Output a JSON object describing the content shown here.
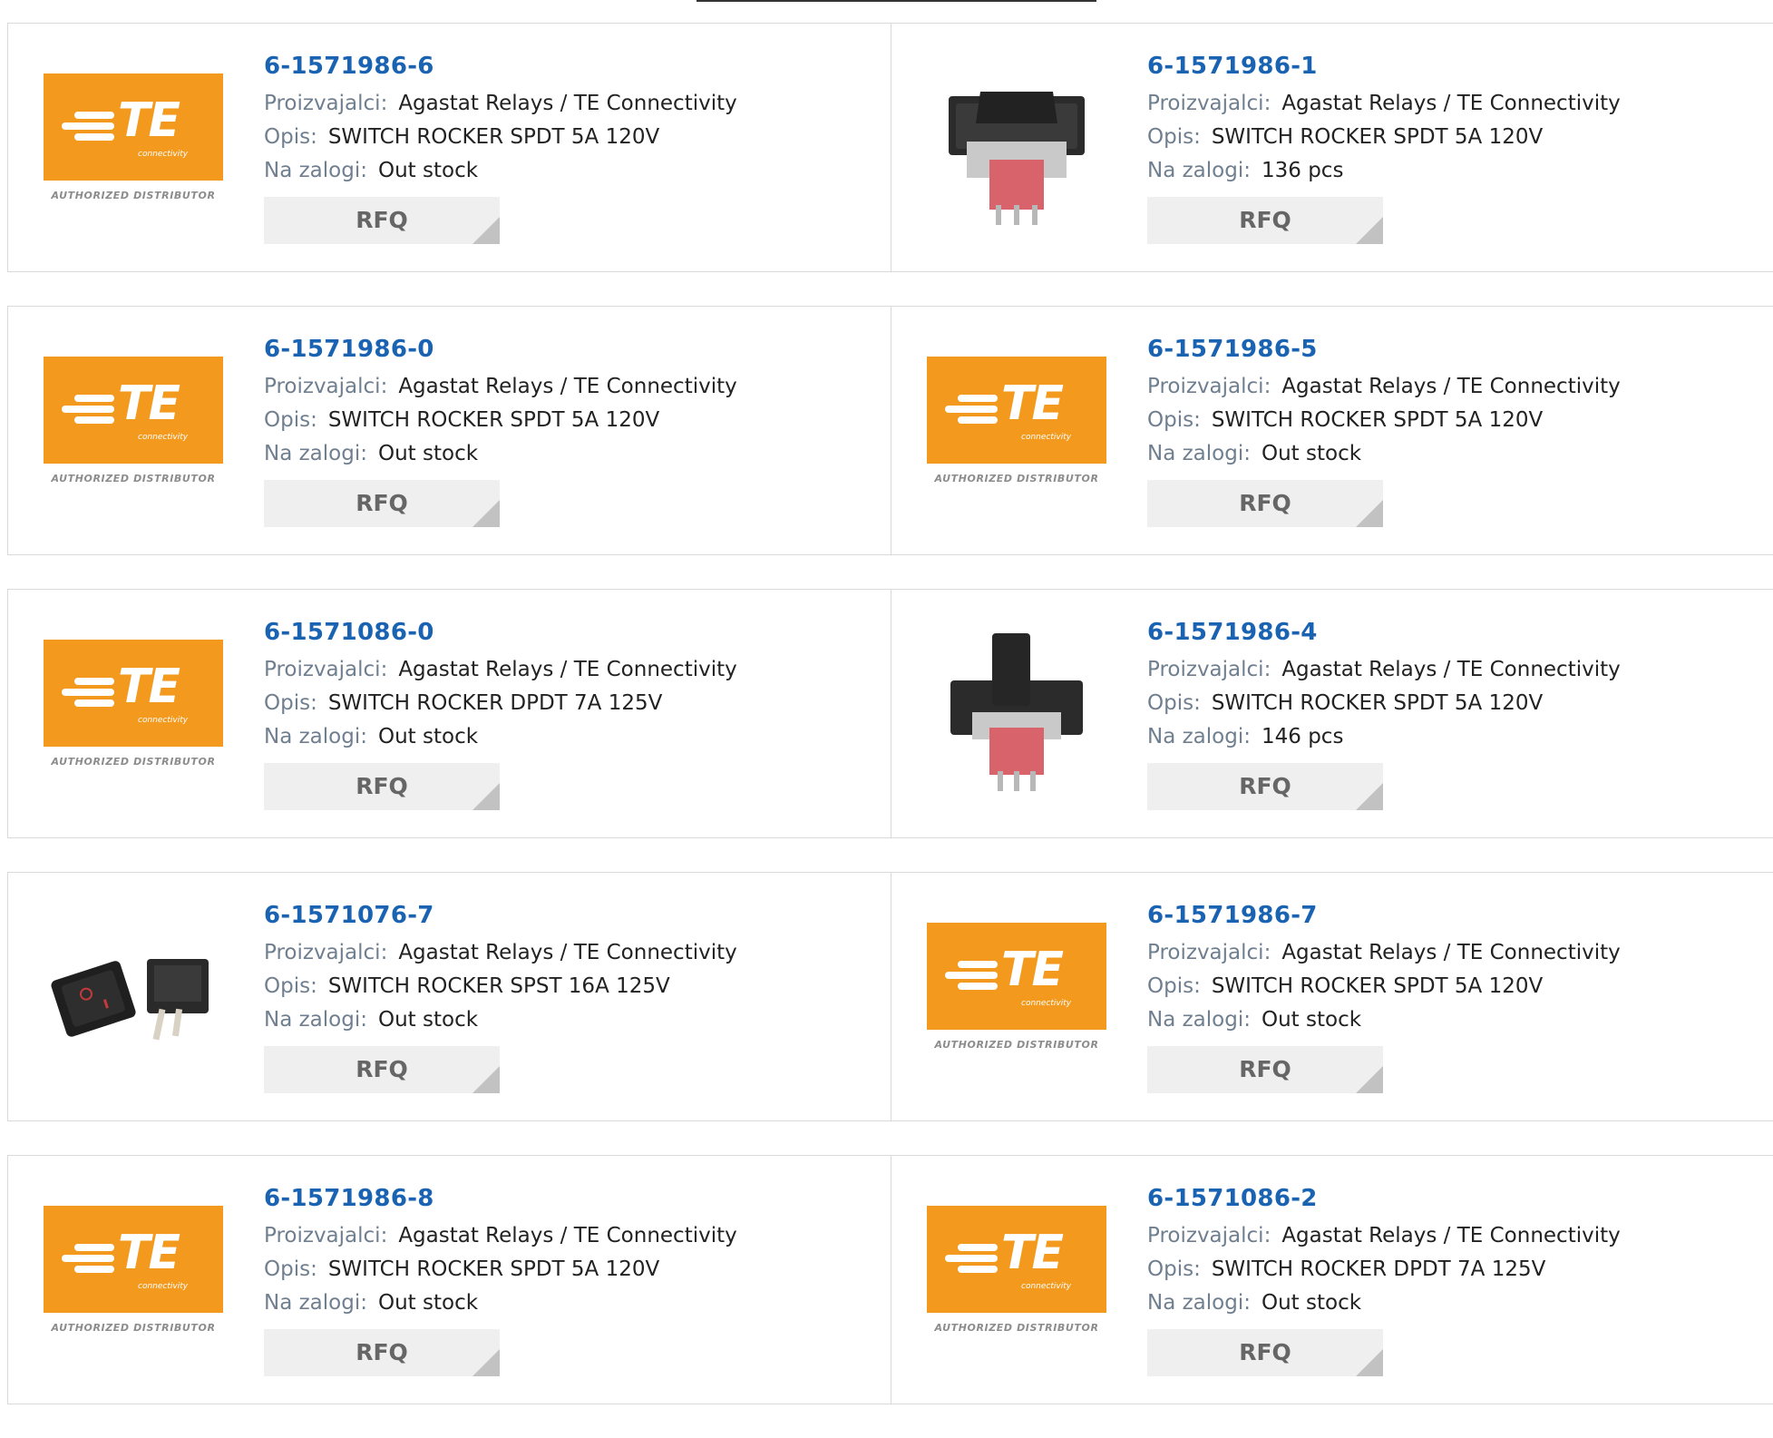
{
  "labels": {
    "manufacturer": "Proizvajalci:",
    "description": "Opis:",
    "stock": "Na zalogi:",
    "rfq": "RFQ"
  },
  "colors": {
    "part_link": "#1a63b3",
    "te_orange": "#f39a1e",
    "card_border": "#d9d9d9"
  },
  "te_logo": {
    "word": "TE",
    "sub": "connectivity",
    "caption": "AUTHORIZED DISTRIBUTOR"
  },
  "products": [
    {
      "part": "6-1571986-6",
      "manufacturer": "Agastat Relays / TE Connectivity",
      "description": "SWITCH ROCKER SPDT 5A 120V",
      "stock": "Out stock",
      "image": "te-logo"
    },
    {
      "part": "6-1571986-1",
      "manufacturer": "Agastat Relays / TE Connectivity",
      "description": "SWITCH ROCKER SPDT 5A 120V",
      "stock": "136 pcs",
      "image": "rocker-switch-photo"
    },
    {
      "part": "6-1571986-0",
      "manufacturer": "Agastat Relays / TE Connectivity",
      "description": "SWITCH ROCKER SPDT 5A 120V",
      "stock": "Out stock",
      "image": "te-logo"
    },
    {
      "part": "6-1571986-5",
      "manufacturer": "Agastat Relays / TE Connectivity",
      "description": "SWITCH ROCKER SPDT 5A 120V",
      "stock": "Out stock",
      "image": "te-logo"
    },
    {
      "part": "6-1571086-0",
      "manufacturer": "Agastat Relays / TE Connectivity",
      "description": "SWITCH ROCKER DPDT 7A 125V",
      "stock": "Out stock",
      "image": "te-logo"
    },
    {
      "part": "6-1571986-4",
      "manufacturer": "Agastat Relays / TE Connectivity",
      "description": "SWITCH ROCKER SPDT 5A 120V",
      "stock": "146 pcs",
      "image": "paddle-switch-photo"
    },
    {
      "part": "6-1571076-7",
      "manufacturer": "Agastat Relays / TE Connectivity",
      "description": "SWITCH ROCKER SPST 16A 125V",
      "stock": "Out stock",
      "image": "black-rocker-pair-photo"
    },
    {
      "part": "6-1571986-7",
      "manufacturer": "Agastat Relays / TE Connectivity",
      "description": "SWITCH ROCKER SPDT 5A 120V",
      "stock": "Out stock",
      "image": "te-logo"
    },
    {
      "part": "6-1571986-8",
      "manufacturer": "Agastat Relays / TE Connectivity",
      "description": "SWITCH ROCKER SPDT 5A 120V",
      "stock": "Out stock",
      "image": "te-logo"
    },
    {
      "part": "6-1571086-2",
      "manufacturer": "Agastat Relays / TE Connectivity",
      "description": "SWITCH ROCKER DPDT 7A 125V",
      "stock": "Out stock",
      "image": "te-logo"
    }
  ]
}
